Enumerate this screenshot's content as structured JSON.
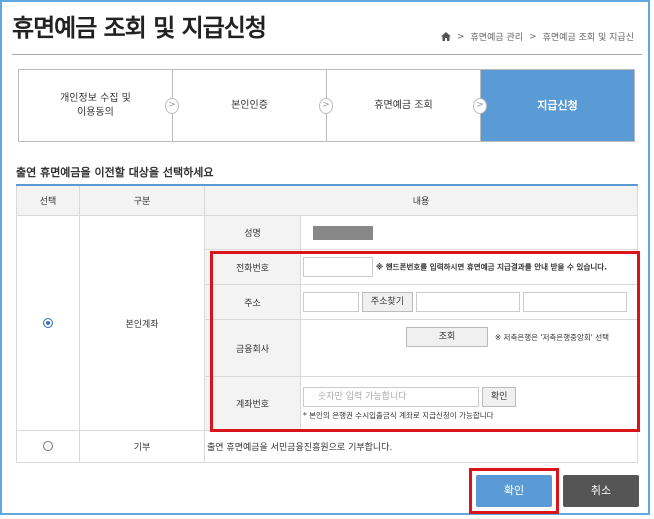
{
  "header": {
    "title": "휴면예금 조회 및 지급신청",
    "breadcrumb": [
      "휴면예금 관리",
      "휴면예금 조회 및 지급신"
    ]
  },
  "steps": [
    {
      "label": "개인정보 수집 및\n이용동의",
      "active": false
    },
    {
      "label": "본인인증",
      "active": false
    },
    {
      "label": "휴면예금 조회",
      "active": false
    },
    {
      "label": "지급신청",
      "active": true
    }
  ],
  "section_title": "출연 휴면예금을 이전할 대상을 선택하세요",
  "table": {
    "headers": [
      "선택",
      "구분",
      "내용"
    ],
    "row1": {
      "category": "본인계좌",
      "selected": true,
      "fields": {
        "name_label": "성명",
        "phone_label": "전화번호",
        "phone_note": "※ 핸드폰번호를 입력하시면 휴면예금 지급결과를 안내 받을 수 있습니다.",
        "address_label": "주소",
        "address_search": "주소찾기",
        "bank_label": "금융회사",
        "bank_lookup": "조회",
        "bank_note": "※ 저축은행은 '저축은행중앙회' 선택",
        "account_label": "계좌번호",
        "account_placeholder": "숫자만 입력 가능합니다",
        "account_confirm": "확인",
        "account_note": "* 본인의 은행권 수시입출금식 계좌로 지급신청이 가능합니다"
      }
    },
    "row2": {
      "category": "기부",
      "selected": false,
      "content": "출연 휴면예금을 서민금융진흥원으로 기부합니다."
    }
  },
  "buttons": {
    "confirm": "확인",
    "cancel": "취소"
  },
  "colors": {
    "accent": "#5b9bd5",
    "highlight": "#d9141b",
    "frame": "#5fa9de"
  }
}
